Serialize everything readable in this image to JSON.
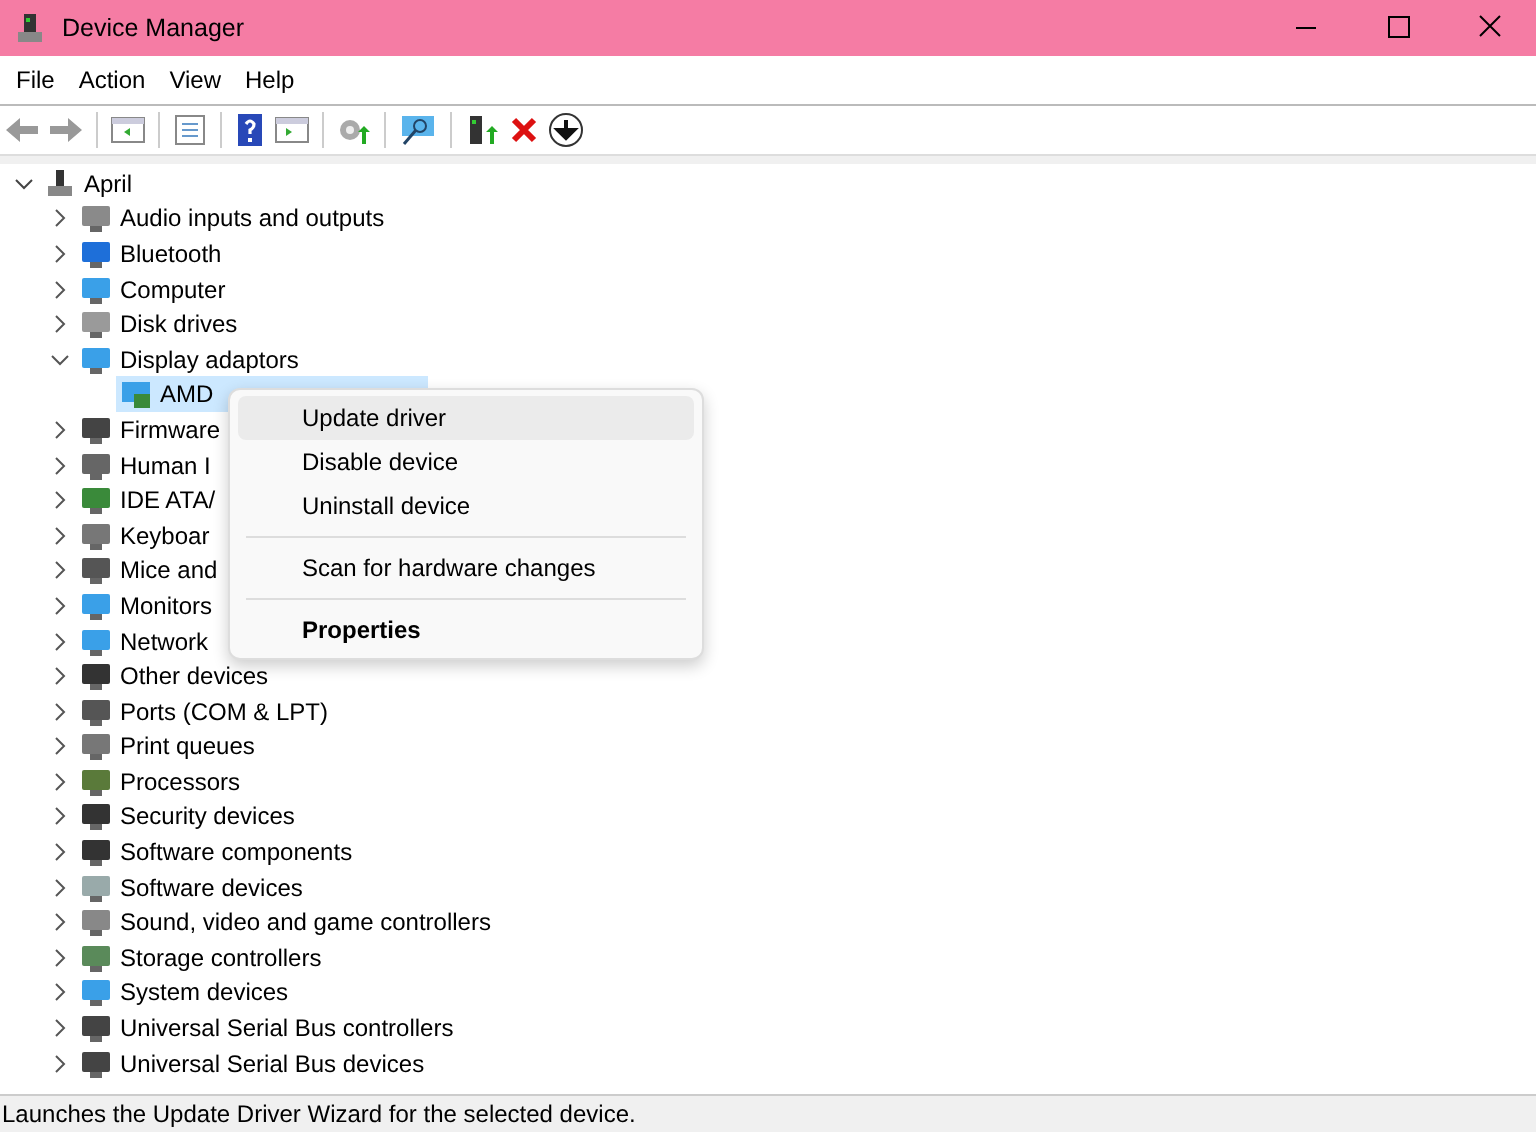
{
  "window": {
    "title": "Device Manager"
  },
  "menu_bar": [
    "File",
    "Action",
    "View",
    "Help"
  ],
  "tree": {
    "label": "April",
    "expanded": true,
    "children": [
      {
        "label": "Audio inputs and outputs",
        "expanded": false
      },
      {
        "label": "Bluetooth",
        "expanded": false
      },
      {
        "label": "Computer",
        "expanded": false
      },
      {
        "label": "Disk drives",
        "expanded": false
      },
      {
        "label": "Display adaptors",
        "expanded": true,
        "children": [
          {
            "label": "AMD",
            "selected": true
          }
        ]
      },
      {
        "label": "Firmware",
        "expanded": false
      },
      {
        "label": "Human I",
        "expanded": false
      },
      {
        "label": "IDE ATA/",
        "expanded": false
      },
      {
        "label": "Keyboar",
        "expanded": false
      },
      {
        "label": "Mice and",
        "expanded": false
      },
      {
        "label": "Monitors",
        "expanded": false
      },
      {
        "label": "Network",
        "expanded": false
      },
      {
        "label": "Other devices",
        "expanded": false
      },
      {
        "label": "Ports (COM & LPT)",
        "expanded": false
      },
      {
        "label": "Print queues",
        "expanded": false
      },
      {
        "label": "Processors",
        "expanded": false
      },
      {
        "label": "Security devices",
        "expanded": false
      },
      {
        "label": "Software components",
        "expanded": false
      },
      {
        "label": "Software devices",
        "expanded": false
      },
      {
        "label": "Sound, video and game controllers",
        "expanded": false
      },
      {
        "label": "Storage controllers",
        "expanded": false
      },
      {
        "label": "System devices",
        "expanded": false
      },
      {
        "label": "Universal Serial Bus controllers",
        "expanded": false
      },
      {
        "label": "Universal Serial Bus devices",
        "expanded": false
      }
    ]
  },
  "context_menu": [
    {
      "kind": "item",
      "label": "Update driver",
      "selected": true
    },
    {
      "kind": "item",
      "label": "Disable device",
      "selected": false
    },
    {
      "kind": "item",
      "label": "Uninstall device",
      "selected": false
    },
    {
      "kind": "separator"
    },
    {
      "kind": "item",
      "label": "Scan for hardware changes",
      "selected": false
    },
    {
      "kind": "separator"
    },
    {
      "kind": "default",
      "label": "Properties",
      "selected": false
    }
  ],
  "status_bar": "Launches the Update Driver Wizard for the selected device."
}
